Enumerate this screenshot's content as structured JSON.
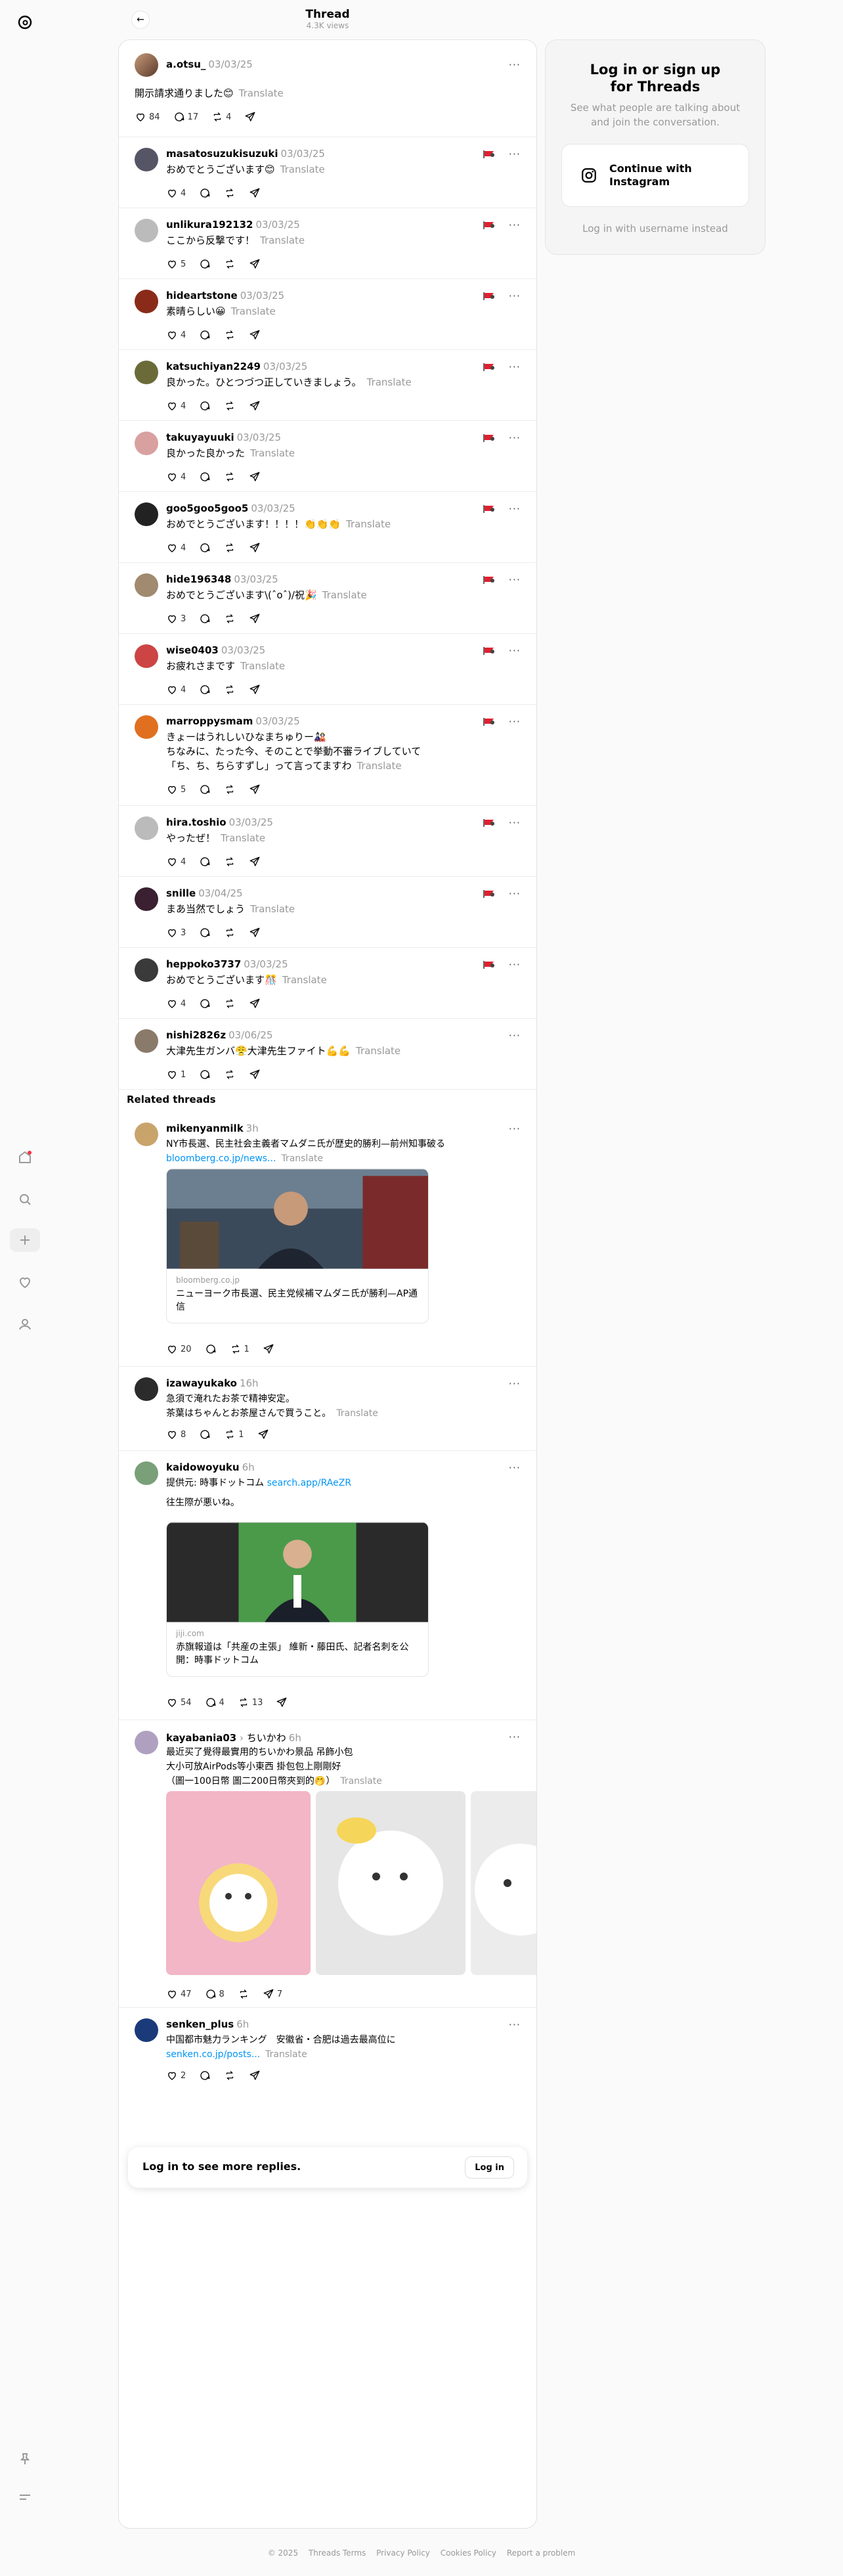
{
  "header": {
    "title": "Thread",
    "views": "4.3K views"
  },
  "main_post": {
    "username": "a.otsu_",
    "date": "03/03/25",
    "text": "開示請求通りました😊",
    "translate": "Translate",
    "likes": "84",
    "replies": "17",
    "reposts": "4"
  },
  "replies": [
    {
      "username": "masatosuzukisuzuki",
      "date": "03/03/25",
      "text": "おめでとうございます😊",
      "likes": "4"
    },
    {
      "username": "unlikura192132",
      "date": "03/03/25",
      "text": "ここから反撃です！",
      "likes": "5"
    },
    {
      "username": "hideartstone",
      "date": "03/03/25",
      "text": "素晴らしい😀",
      "likes": "4"
    },
    {
      "username": "katsuchiyan2249",
      "date": "03/03/25",
      "text": "良かった。ひとつづつ正していきましょう。",
      "likes": "4"
    },
    {
      "username": "takuyayuuki",
      "date": "03/03/25",
      "text": "良かった良かった",
      "likes": "4"
    },
    {
      "username": "goo5goo5goo5",
      "date": "03/03/25",
      "text": "おめでとうございます！！！！👏👏👏",
      "likes": "4"
    },
    {
      "username": "hide196348",
      "date": "03/03/25",
      "text": "おめでとうございます\\(ˆoˆ)/祝🎉",
      "likes": "3"
    },
    {
      "username": "wise0403",
      "date": "03/03/25",
      "text": "お疲れさまです",
      "likes": "4"
    },
    {
      "username": "marroppysmam",
      "date": "03/03/25",
      "text": "きょーはうれしいひなまちゅりー🎎",
      "text2": "ちなみに、たった今、そのことで挙動不審ライブしていて",
      "text3": "「ち、ち、ちらすずし」って言ってますわ",
      "likes": "5"
    },
    {
      "username": "hira.toshio",
      "date": "03/03/25",
      "text": "やったぜ！",
      "likes": "4"
    },
    {
      "username": "snille",
      "date": "03/04/25",
      "text": "まあ当然でしょう",
      "likes": "3"
    },
    {
      "username": "heppoko3737",
      "date": "03/03/25",
      "text": "おめでとうございます🎊",
      "likes": "4"
    },
    {
      "username": "nishi2826z",
      "date": "03/06/25",
      "text": "大津先生ガンバ😤大津先生ファイト💪💪",
      "likes": "1"
    }
  ],
  "related": {
    "title": "Related threads",
    "posts": [
      {
        "username": "mikenyanmilk",
        "date": "3h",
        "text": "NY市長選、民主社会主義者マムダニ氏が歴史的勝利—前州知事破る",
        "link": "bloomberg.co.jp/news...",
        "card_source": "bloomberg.co.jp",
        "card_title": "ニューヨーク市長選、民主党候補マムダニ氏が勝利—AP通信",
        "likes": "20",
        "reposts": "1"
      },
      {
        "username": "izawayukako",
        "date": "16h",
        "text": "急須で淹れたお茶で精神安定。",
        "text2": "茶葉はちゃんとお茶屋さんで買うこと。",
        "likes": "8",
        "reposts": "1"
      },
      {
        "username": "kaidowoyuku",
        "date": "6h",
        "text": "提供元: 時事ドットコム",
        "link": "search.app/RAeZR",
        "text2": "往生際が悪いね。",
        "card_source": "jiji.com",
        "card_title": "赤旗報道は「共産の主張」 維新・藤田氏、記者名刺を公開：時事ドットコム",
        "likes": "54",
        "replies": "4",
        "reposts": "13"
      },
      {
        "username": "kayabania03",
        "arrow": "›",
        "topic": "ちいかわ",
        "date": "6h",
        "text": "最近买了覺得最實用的ちいかわ景品 吊飾小包",
        "text2": "大小可放AirPods等小東西 掛包包上剛剛好",
        "text3": "（圖一100日幣 圖二200日幣夾到的🤭）",
        "likes": "47",
        "replies": "8",
        "shares": "7"
      },
      {
        "username": "senken_plus",
        "date": "6h",
        "text": "中国都市魅力ランキング　安徽省・合肥は過去最高位に",
        "link": "senken.co.jp/posts...",
        "likes": "2"
      }
    ]
  },
  "login_prompt": {
    "text": "Log in to see more replies.",
    "button": "Log in"
  },
  "login_card": {
    "title_line1": "Log in or sign up",
    "title_line2": "for Threads",
    "subtitle_line1": "See what people are talking about",
    "subtitle_line2": "and join the conversation.",
    "instagram_line1": "Continue with",
    "instagram_line2": "Instagram",
    "alt_login": "Log in with username instead"
  },
  "footer": {
    "copyright": "© 2025",
    "terms": "Threads Terms",
    "privacy": "Privacy Policy",
    "cookies": "Cookies Policy",
    "report": "Report a problem"
  },
  "colors": {
    "link": "#0095f6",
    "notification_dot": "#ff3040",
    "muted": "#999999"
  },
  "icons": [
    "threads-logo-icon",
    "home-icon",
    "search-icon",
    "plus-icon",
    "heart-icon",
    "profile-icon",
    "pin-icon",
    "menu-icon",
    "back-arrow-icon",
    "like-icon",
    "comment-icon",
    "repost-icon",
    "share-icon",
    "more-icon",
    "instagram-icon",
    "flag-icon"
  ]
}
